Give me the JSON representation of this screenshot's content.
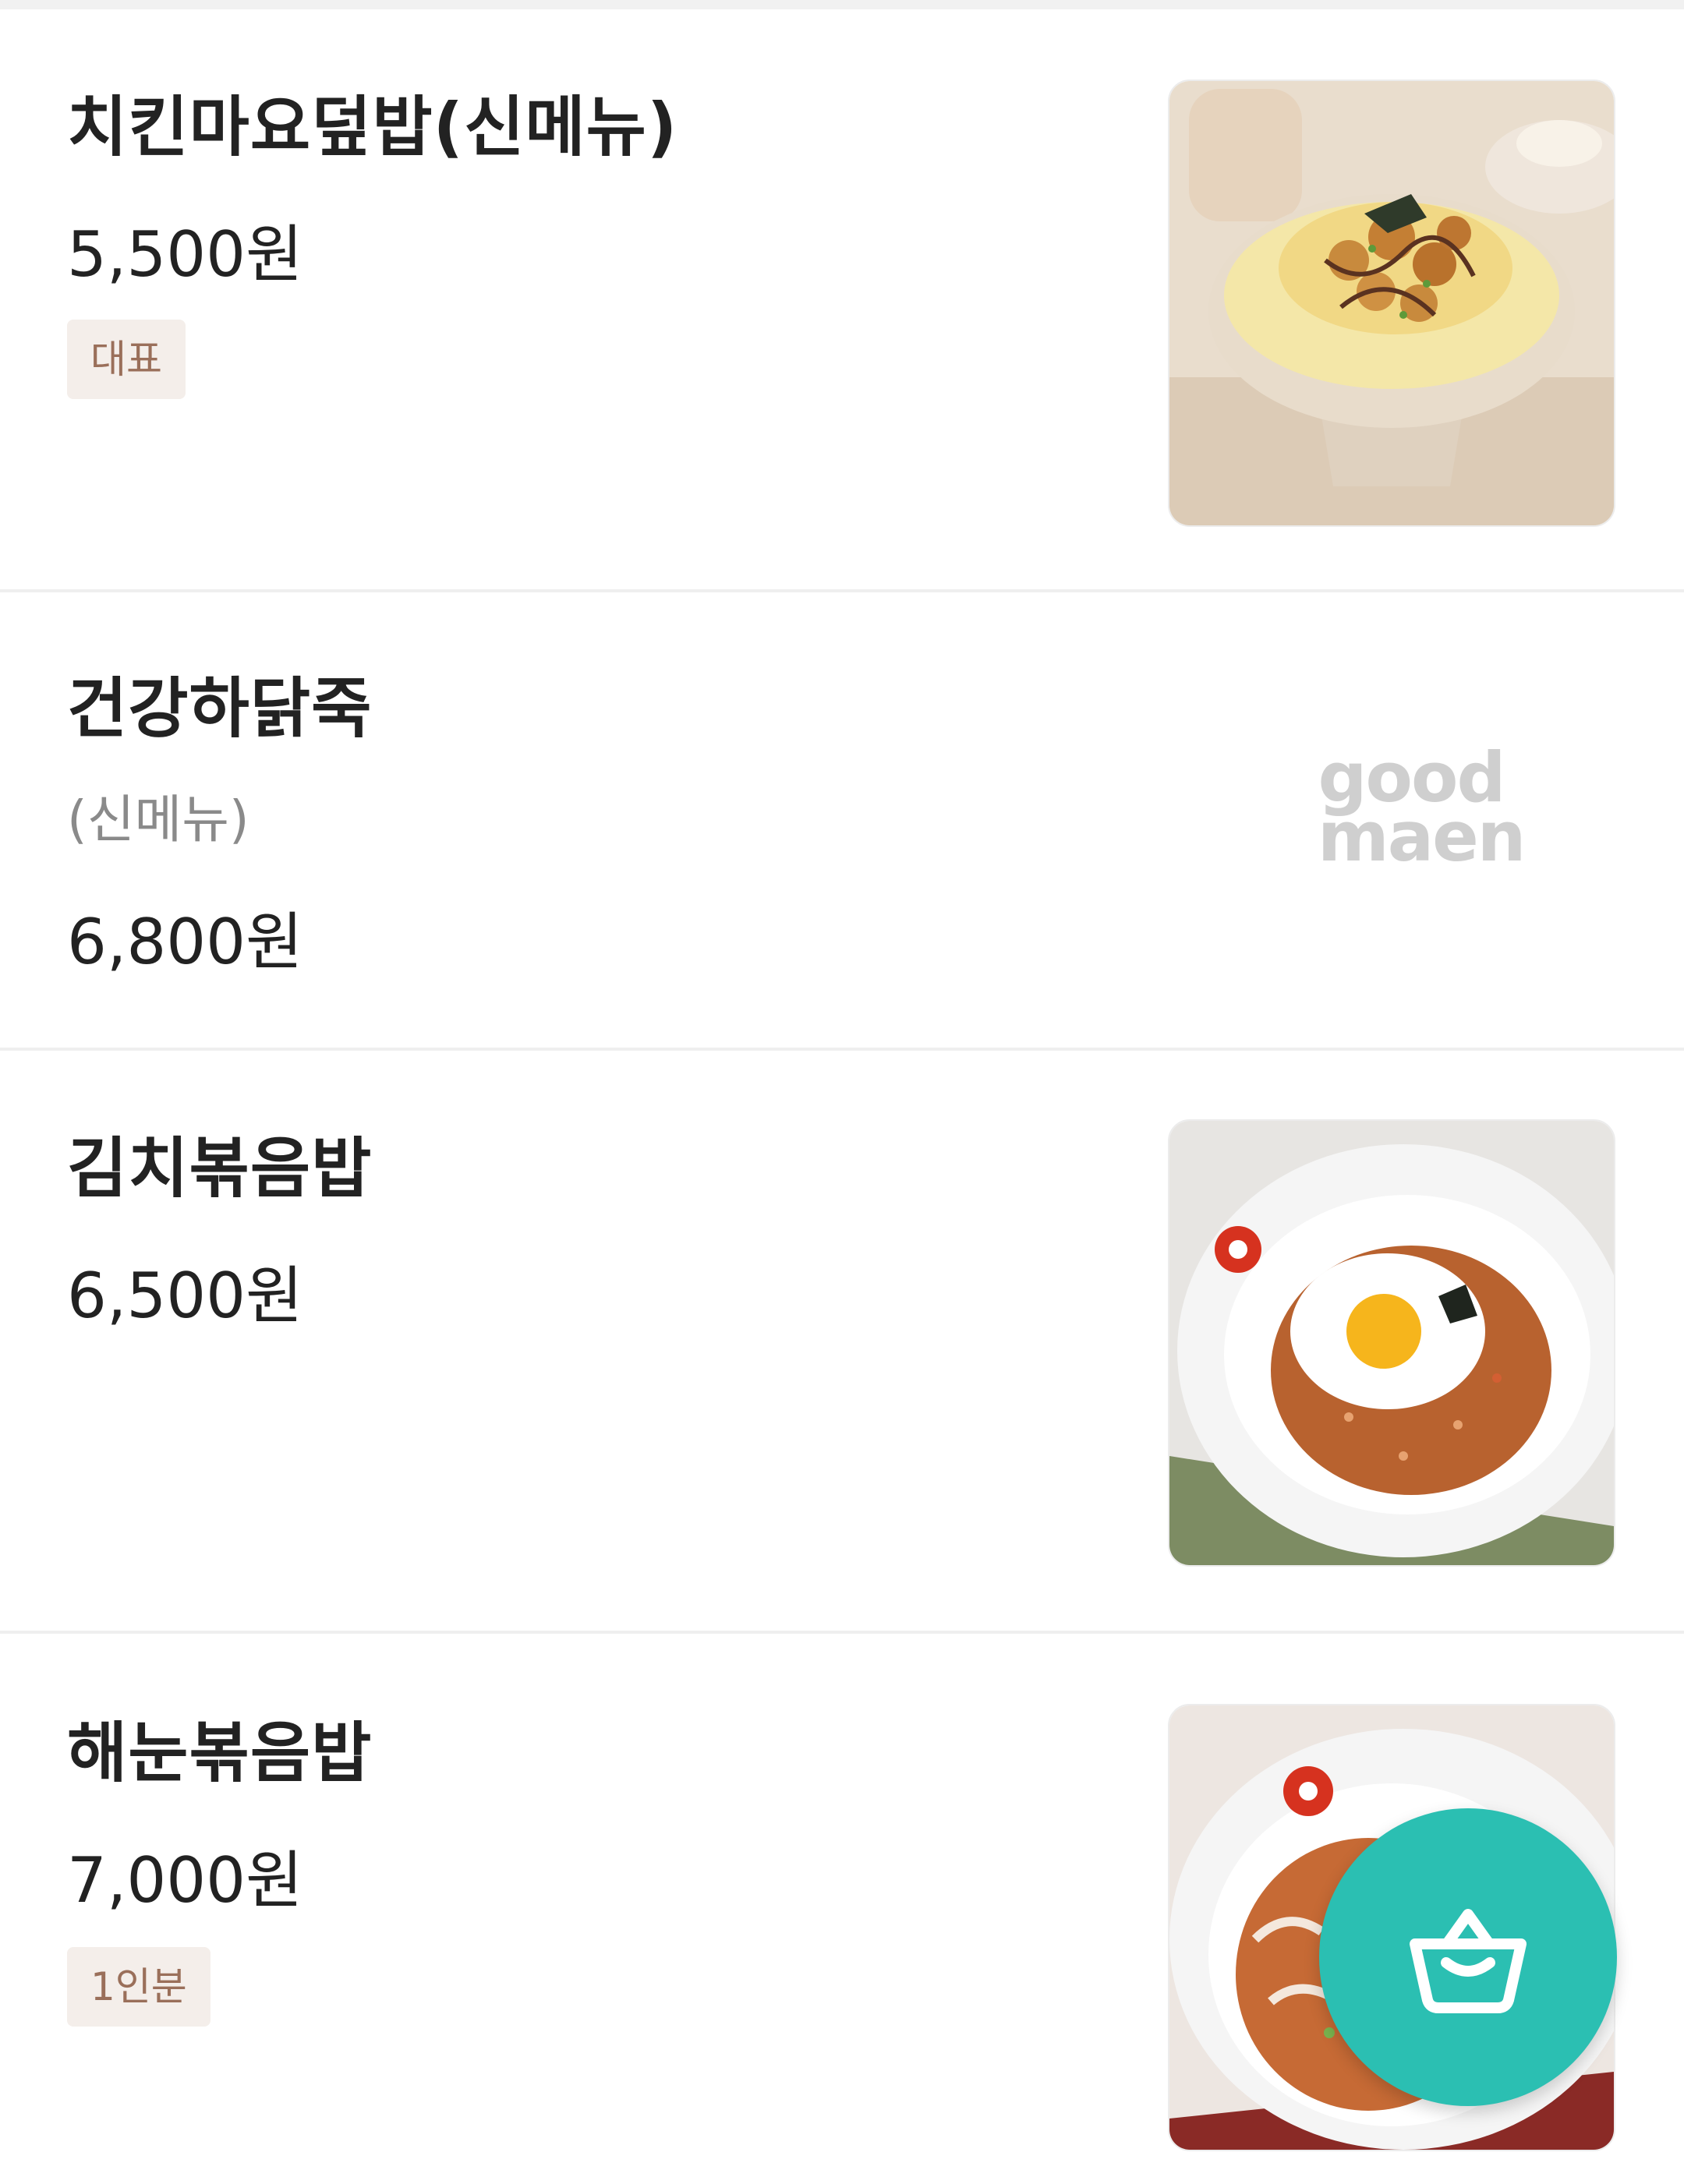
{
  "menu": {
    "items": [
      {
        "name": "치킨마요덮밥(신메뉴)",
        "price": "5,500원",
        "badge": "대표",
        "image": "chicken-mayo-rice-bowl-photo"
      },
      {
        "name": "건강하닭죽",
        "subtitle": "(신메뉴)",
        "price": "6,800원",
        "image_placeholder": "good maen"
      },
      {
        "name": "김치볶음밥",
        "price": "6,500원",
        "image": "kimchi-fried-rice-photo"
      },
      {
        "name": "해눈볶음밥",
        "price": "7,000원",
        "badge": "1인분",
        "image": "seafood-fried-rice-photo"
      }
    ]
  },
  "cart_button": {
    "icon": "shopping-basket-icon",
    "color": "#2bbfb2"
  },
  "colors": {
    "badge_background": "#f4eeea",
    "badge_text": "#9a6f5a",
    "divider": "#efefef"
  }
}
